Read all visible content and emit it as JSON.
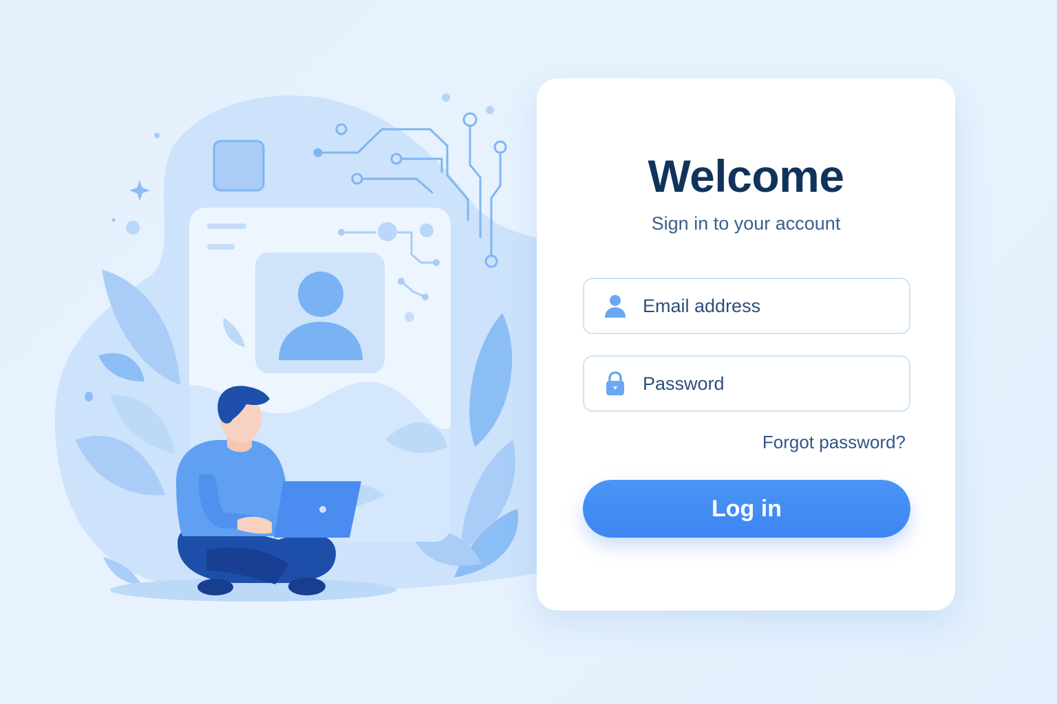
{
  "login": {
    "title": "Welcome",
    "subtitle": "Sign in to your account",
    "email": {
      "placeholder": "Email address",
      "value": "",
      "icon": "user-icon"
    },
    "password": {
      "placeholder": "Password",
      "value": "",
      "icon": "lock-icon"
    },
    "forgot_password_label": "Forgot password?",
    "submit_label": "Log in"
  },
  "colors": {
    "background": "#e6f2fd",
    "card": "#ffffff",
    "title": "#10335c",
    "text": "#2c4e7c",
    "accent": "#4a94f6",
    "field_border": "#cfe3f8",
    "illustration_light": "#cfe4fb",
    "illustration_mid": "#8cbef6",
    "illustration_dark": "#1d4faa"
  },
  "illustration": {
    "icons": [
      "profile-card-icon",
      "avatar-icon",
      "person-with-laptop-icon",
      "circuit-lines-icon",
      "leaf-icon",
      "sparkle-icon"
    ]
  }
}
